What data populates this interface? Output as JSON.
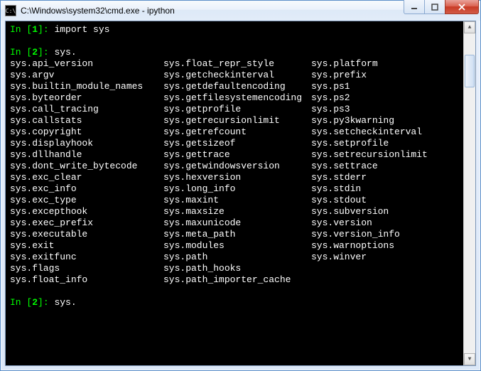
{
  "window": {
    "title": "C:\\Windows\\system32\\cmd.exe - ipython"
  },
  "terminal": {
    "line1": {
      "prompt": "In [",
      "num": "1",
      "prompt_end": "]:",
      "code": " import sys"
    },
    "line2": {
      "prompt": "In [",
      "num": "2",
      "prompt_end": "]:",
      "code": " sys."
    },
    "line3": {
      "prompt": "In [",
      "num": "2",
      "prompt_end": "]:",
      "code": " sys."
    }
  },
  "completions": [
    [
      "sys.api_version",
      "sys.float_repr_style",
      "sys.platform"
    ],
    [
      "sys.argv",
      "sys.getcheckinterval",
      "sys.prefix"
    ],
    [
      "sys.builtin_module_names",
      "sys.getdefaultencoding",
      "sys.ps1"
    ],
    [
      "sys.byteorder",
      "sys.getfilesystemencoding",
      "sys.ps2"
    ],
    [
      "sys.call_tracing",
      "sys.getprofile",
      "sys.ps3"
    ],
    [
      "sys.callstats",
      "sys.getrecursionlimit",
      "sys.py3kwarning"
    ],
    [
      "sys.copyright",
      "sys.getrefcount",
      "sys.setcheckinterval"
    ],
    [
      "sys.displayhook",
      "sys.getsizeof",
      "sys.setprofile"
    ],
    [
      "sys.dllhandle",
      "sys.gettrace",
      "sys.setrecursionlimit"
    ],
    [
      "sys.dont_write_bytecode",
      "sys.getwindowsversion",
      "sys.settrace"
    ],
    [
      "sys.exc_clear",
      "sys.hexversion",
      "sys.stderr"
    ],
    [
      "sys.exc_info",
      "sys.long_info",
      "sys.stdin"
    ],
    [
      "sys.exc_type",
      "sys.maxint",
      "sys.stdout"
    ],
    [
      "sys.excepthook",
      "sys.maxsize",
      "sys.subversion"
    ],
    [
      "sys.exec_prefix",
      "sys.maxunicode",
      "sys.version"
    ],
    [
      "sys.executable",
      "sys.meta_path",
      "sys.version_info"
    ],
    [
      "sys.exit",
      "sys.modules",
      "sys.warnoptions"
    ],
    [
      "sys.exitfunc",
      "sys.path",
      "sys.winver"
    ],
    [
      "sys.flags",
      "sys.path_hooks",
      ""
    ],
    [
      "sys.float_info",
      "sys.path_importer_cache",
      ""
    ]
  ]
}
